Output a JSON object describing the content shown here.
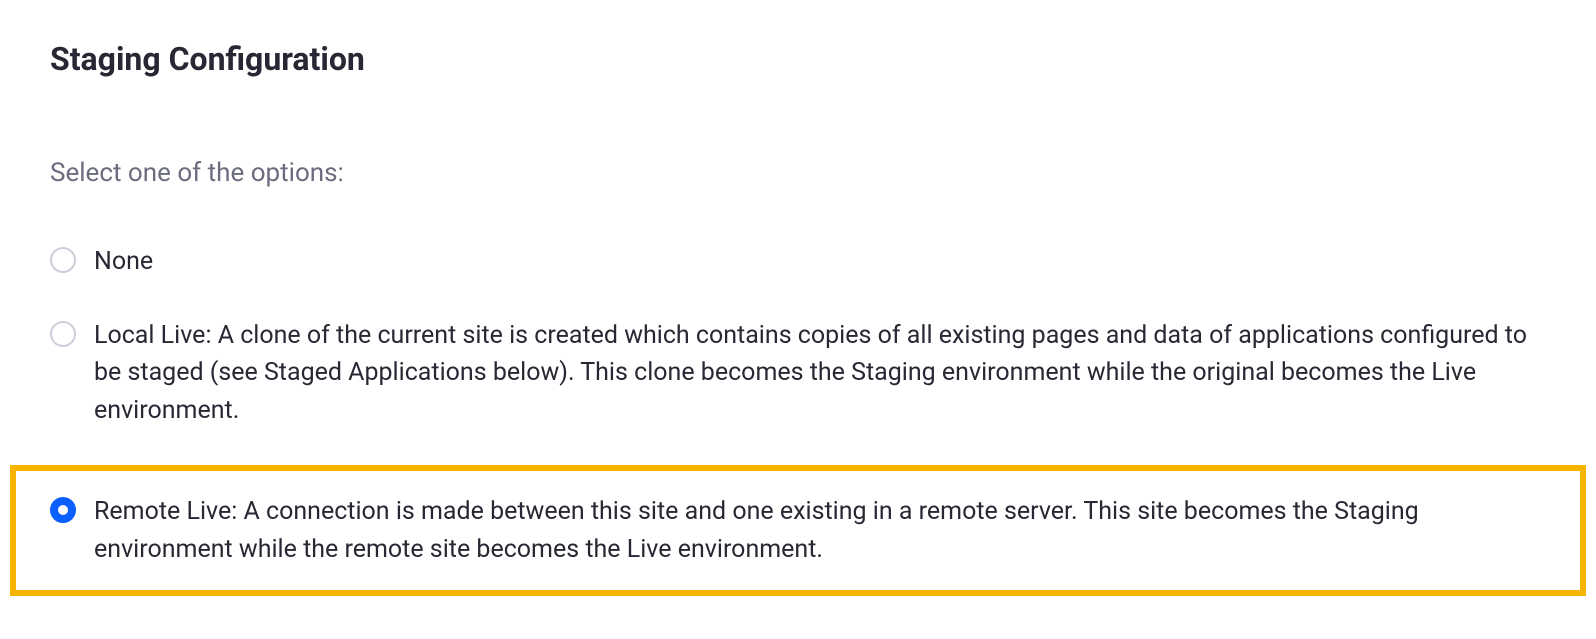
{
  "header": {
    "title": "Staging Configuration"
  },
  "form": {
    "instruction": "Select one of the options:",
    "options": [
      {
        "label": "None",
        "checked": false,
        "highlighted": false
      },
      {
        "label": "Local Live: A clone of the current site is created which contains copies of all existing pages and data of applications configured to be staged (see Staged Applications below). This clone becomes the Staging environment while the original becomes the Live environment.",
        "checked": false,
        "highlighted": false
      },
      {
        "label": "Remote Live: A connection is made between this site and one existing in a remote server. This site becomes the Staging environment while the remote site becomes the Live environment.",
        "checked": true,
        "highlighted": true
      }
    ]
  }
}
